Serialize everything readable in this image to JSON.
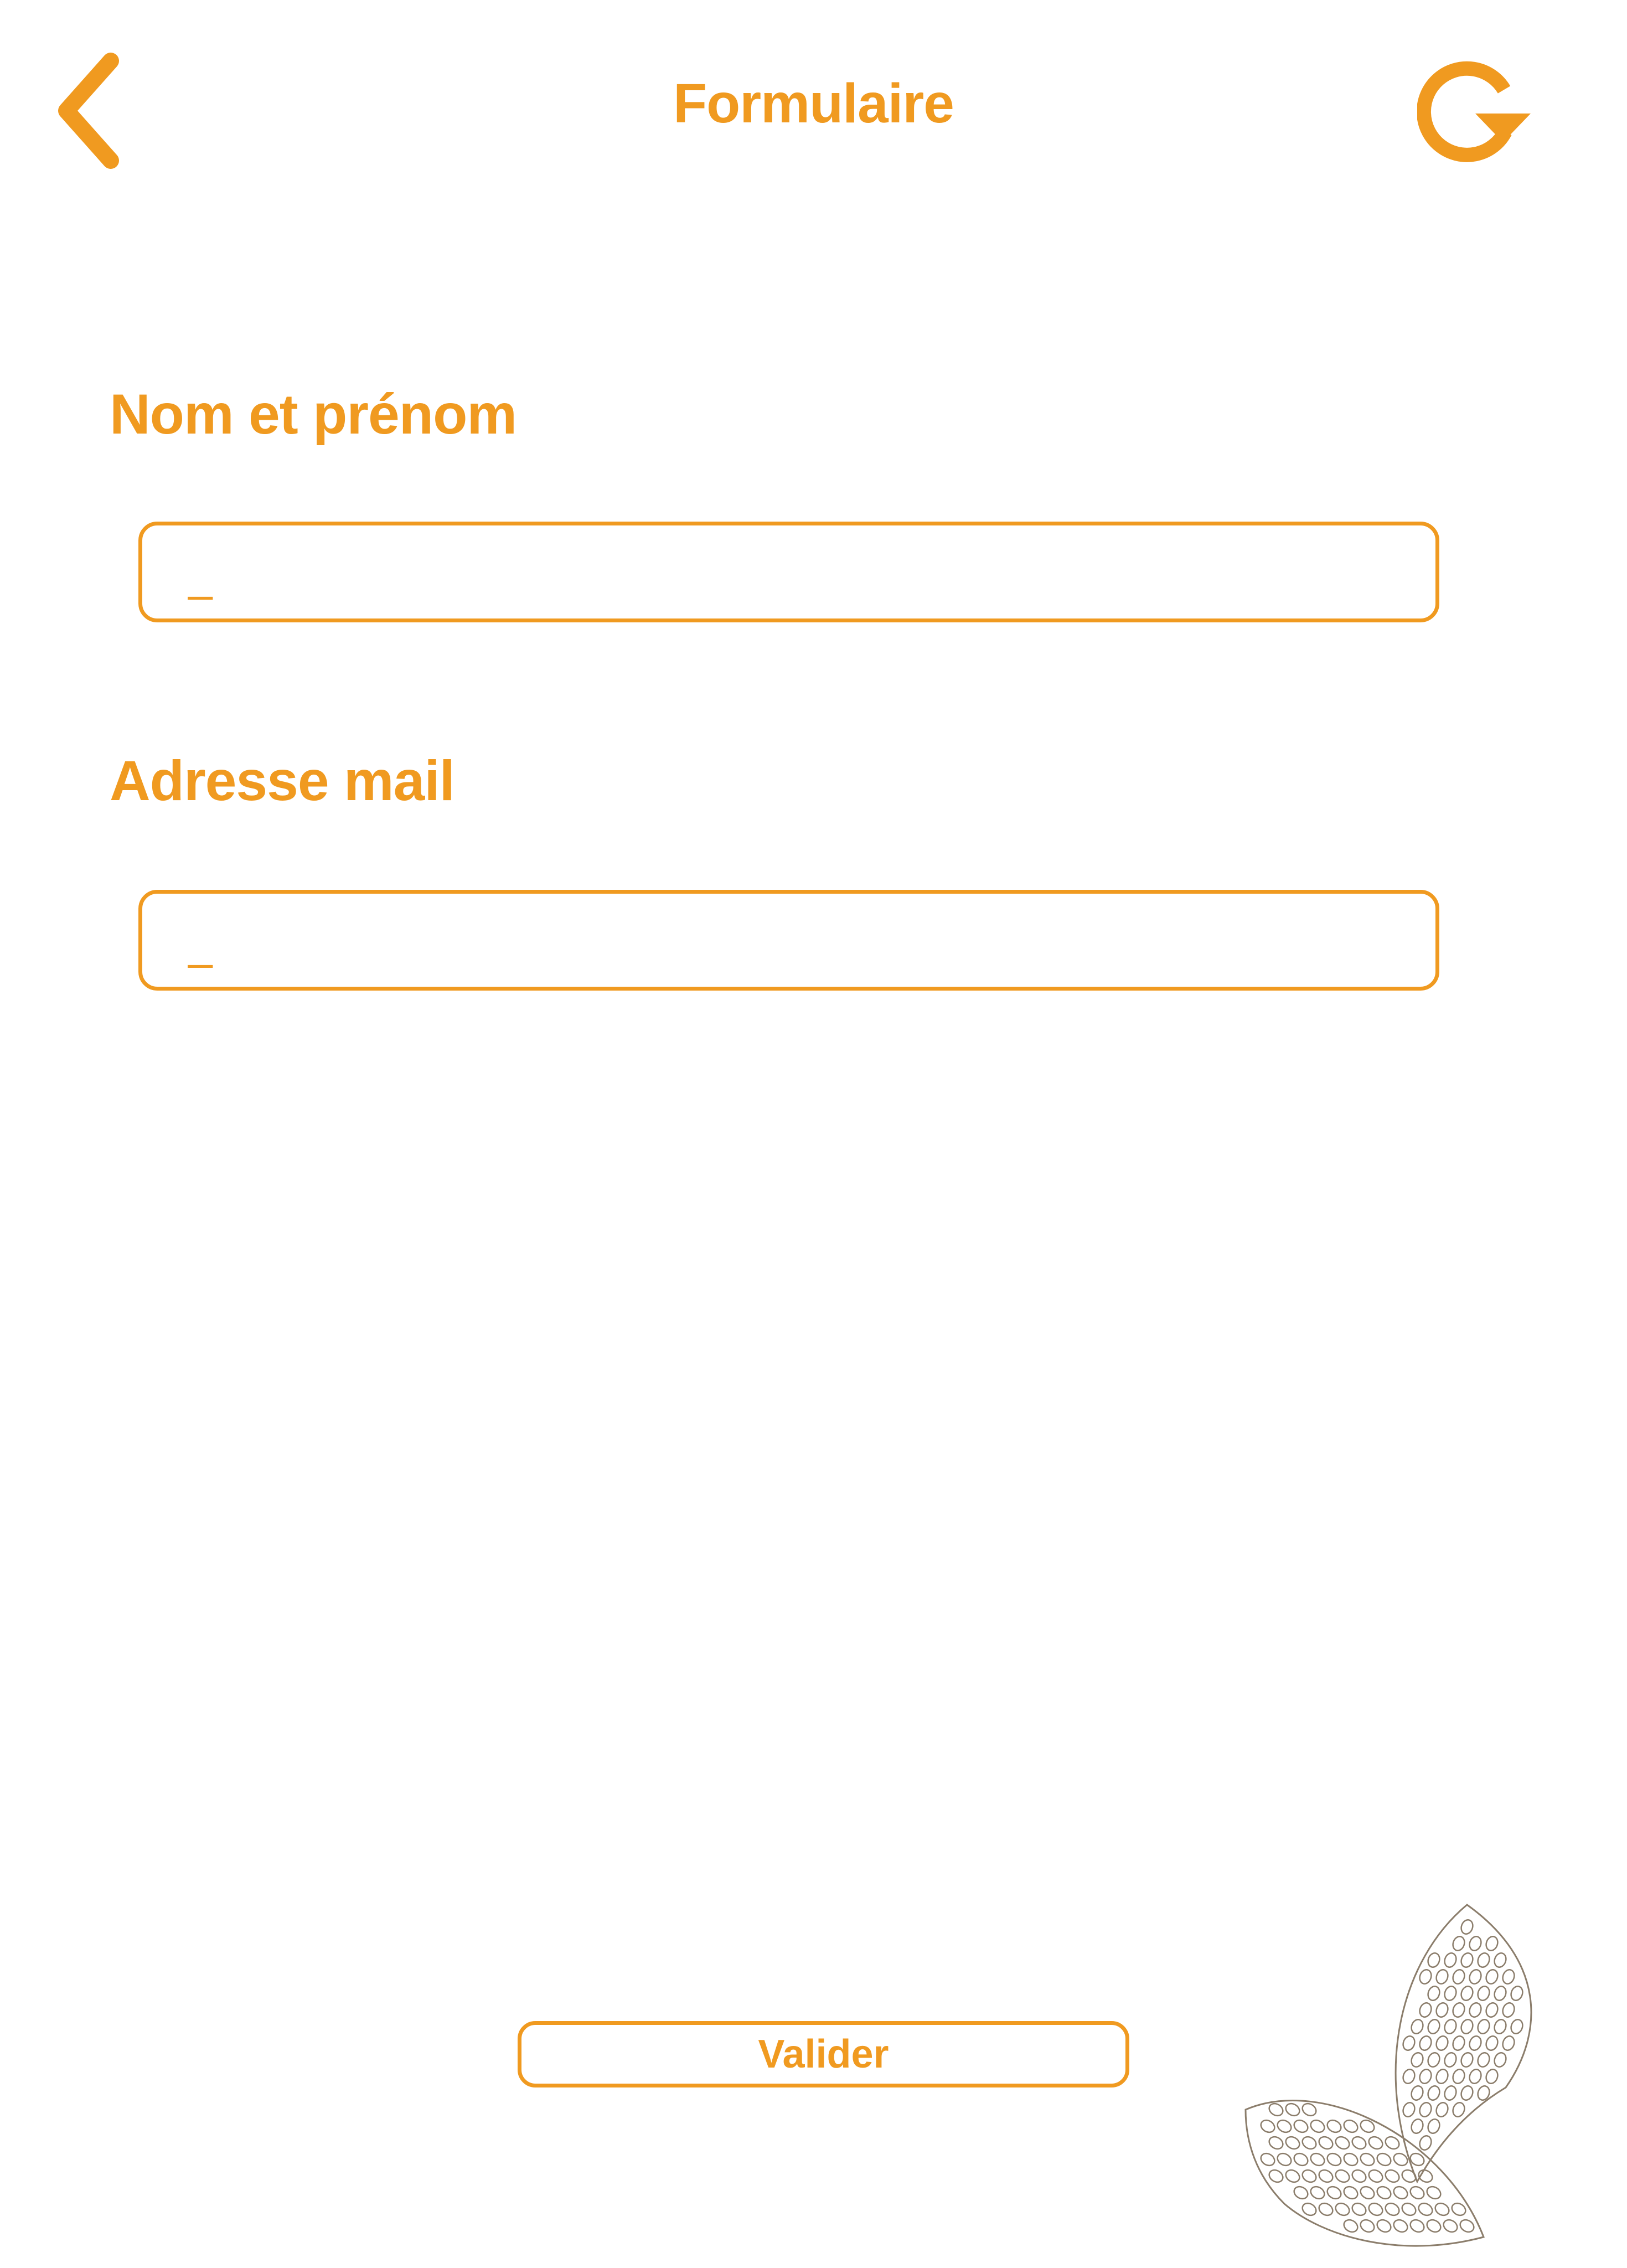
{
  "header": {
    "title": "Formulaire",
    "back_icon": "chevron-left-icon",
    "refresh_icon": "refresh-icon"
  },
  "form": {
    "name_label": "Nom et prénom",
    "name_placeholder": "_",
    "mail_label": "Adresse mail",
    "mail_placeholder": "_",
    "submit_label": "Valider"
  },
  "colors": {
    "accent": "#F09A20",
    "decoration": "#8B7D6B",
    "background": "#FFFFFF"
  },
  "decoration_icon": "cocoa-beans-icon"
}
